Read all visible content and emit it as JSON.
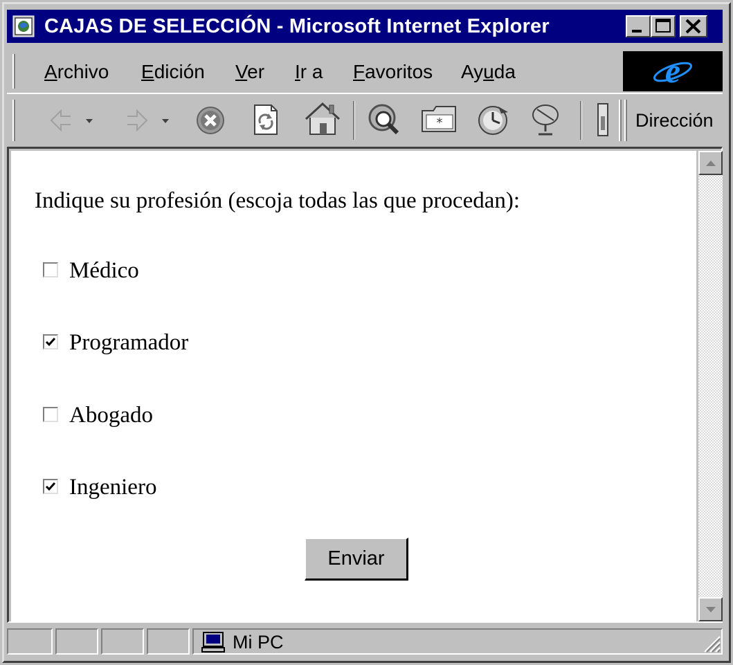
{
  "window": {
    "title": "CAJAS DE SELECCIÓN - Microsoft Internet Explorer"
  },
  "menu": {
    "items": [
      {
        "label_pre": "",
        "label_key": "A",
        "label_post": "rchivo"
      },
      {
        "label_pre": "",
        "label_key": "E",
        "label_post": "dición"
      },
      {
        "label_pre": "",
        "label_key": "V",
        "label_post": "er"
      },
      {
        "label_pre": "",
        "label_key": "I",
        "label_post": "r a"
      },
      {
        "label_pre": "",
        "label_key": "F",
        "label_post": "avoritos"
      },
      {
        "label_pre": "Ay",
        "label_key": "u",
        "label_post": "da"
      }
    ]
  },
  "toolbar": {
    "address_label": "Dirección"
  },
  "page": {
    "prompt": "Indique su profesión (escoja todas las que procedan):",
    "options": [
      {
        "label": "Médico",
        "checked": false
      },
      {
        "label": "Programador",
        "checked": true
      },
      {
        "label": "Abogado",
        "checked": false
      },
      {
        "label": "Ingeniero",
        "checked": true
      }
    ],
    "submit_label": "Enviar"
  },
  "statusbar": {
    "zone_text": "Mi PC"
  },
  "colors": {
    "titlebar": "#000080",
    "face": "#c0c0c0",
    "ie_logo": "#1e90ff"
  },
  "icons": [
    "app-icon",
    "minimize-icon",
    "maximize-icon",
    "close-icon",
    "ie-logo-icon",
    "back-icon",
    "forward-icon",
    "stop-icon",
    "refresh-icon",
    "home-icon",
    "search-icon",
    "favorites-icon",
    "history-icon",
    "channels-icon",
    "computer-icon",
    "resize-grip-icon"
  ]
}
